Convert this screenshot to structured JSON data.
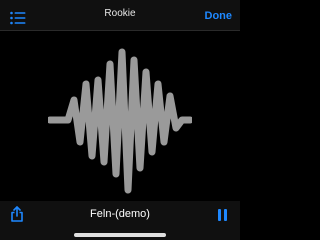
{
  "header": {
    "title": "Rookie",
    "done_label": "Done",
    "left_icon": "list-icon"
  },
  "player": {
    "track_name": "Feln-(demo)",
    "waveform_icon": "waveform-icon",
    "share_icon": "share-icon",
    "pause_icon": "pause-icon"
  },
  "colors": {
    "accent": "#1e88ff",
    "background": "#000000",
    "bar_background": "#101010",
    "waveform": "#9a9a9a"
  }
}
